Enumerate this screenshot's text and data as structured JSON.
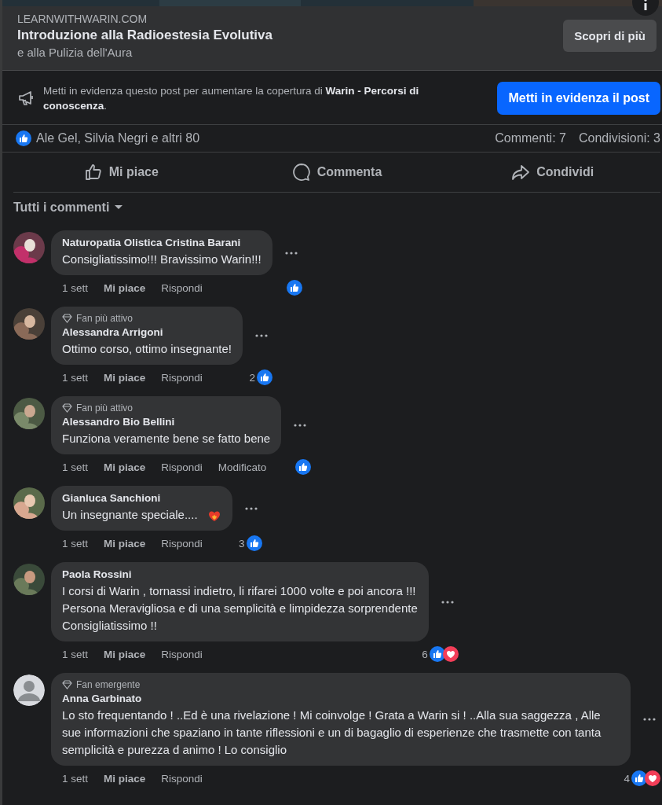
{
  "link_card": {
    "domain": "LEARNWITHWARIN.COM",
    "title": "Introduzione alla Radioestesia Evolutiva",
    "subtitle": "e alla Pulizia dell'Aura",
    "button": "Scopri di più"
  },
  "boost": {
    "text": "Metti in evidenza questo post per aumentare la copertura di **Warin - Percorsi di conoscenza**.",
    "button": "Metti in evidenza il post"
  },
  "summary": {
    "reactors": "Ale Gel, Silvia Negri e altri 80",
    "comments": "Commenti: 7",
    "shares": "Condivisioni: 3"
  },
  "actions": [
    {
      "kind": "like",
      "label": "Mi piace"
    },
    {
      "kind": "comment",
      "label": "Commenta"
    },
    {
      "kind": "share",
      "label": "Condividi"
    }
  ],
  "filter": "Tutti i commenti",
  "comments": [
    {
      "avatar": {
        "kind": "picture"
      },
      "name": "Naturopatia Olistica Cristina Barani",
      "text": "Consigliatissimo!!! Bravissimo Warin!!!",
      "time": "1 sett",
      "like": "Mi piace",
      "reply": "Rispondi",
      "reactions": [
        {
          "kind": "like"
        }
      ]
    },
    {
      "avatar": {
        "kind": "picture"
      },
      "badge": "Fan più attivo",
      "name": "Alessandra Arrigoni",
      "text": "Ottimo corso, ottimo insegnante!",
      "time": "1 sett",
      "like": "Mi piace",
      "reply": "Rispondi",
      "count": "2",
      "reactions": [
        {
          "kind": "like"
        }
      ]
    },
    {
      "avatar": {
        "kind": "picture"
      },
      "badge": "Fan più attivo",
      "name": "Alessandro Bio Bellini",
      "text": "Funziona veramente bene se fatto bene",
      "time": "1 sett",
      "like": "Mi piace",
      "reply": "Rispondi",
      "edited": "Modificato",
      "reactions": [
        {
          "kind": "like"
        }
      ]
    },
    {
      "avatar": {
        "kind": "picture"
      },
      "name": "Gianluca Sanchioni",
      "text": "Un insegnante speciale....",
      "emoji": {
        "kind": "heart"
      },
      "time": "1 sett",
      "like": "Mi piace",
      "reply": "Rispondi",
      "count": "3",
      "reactions": [
        {
          "kind": "like"
        }
      ]
    },
    {
      "avatar": {
        "kind": "picture"
      },
      "name": "Paola Rossini",
      "text": "I corsi di Warin , tornassi indietro, li rifarei 1000 volte e poi ancora !!!\nPersona Meravigliosa e di una semplicità e limpidezza sorprendente\nConsigliatissimo !!",
      "time": "1 sett",
      "like": "Mi piace",
      "reply": "Rispondi",
      "count": "6",
      "reactions": [
        {
          "kind": "like"
        },
        {
          "kind": "love"
        }
      ]
    },
    {
      "avatar": {
        "kind": "default"
      },
      "badge": "Fan emergente",
      "name": "Anna Garbinato",
      "text": "Lo sto frequentando ! ..Ed è una rivelazione ! Mi coinvolge ! Grata a Warin si ! ..Alla sua saggezza , Alle sue informazioni che spaziano in tante riflessioni e un di bagaglio di esperienze che trasmette con tanta semplicità e purezza d animo ! Lo consiglio",
      "time": "1 sett",
      "like": "Mi piace",
      "reply": "Rispondi",
      "count": "4",
      "reactions": [
        {
          "kind": "like"
        },
        {
          "kind": "love"
        }
      ]
    }
  ]
}
